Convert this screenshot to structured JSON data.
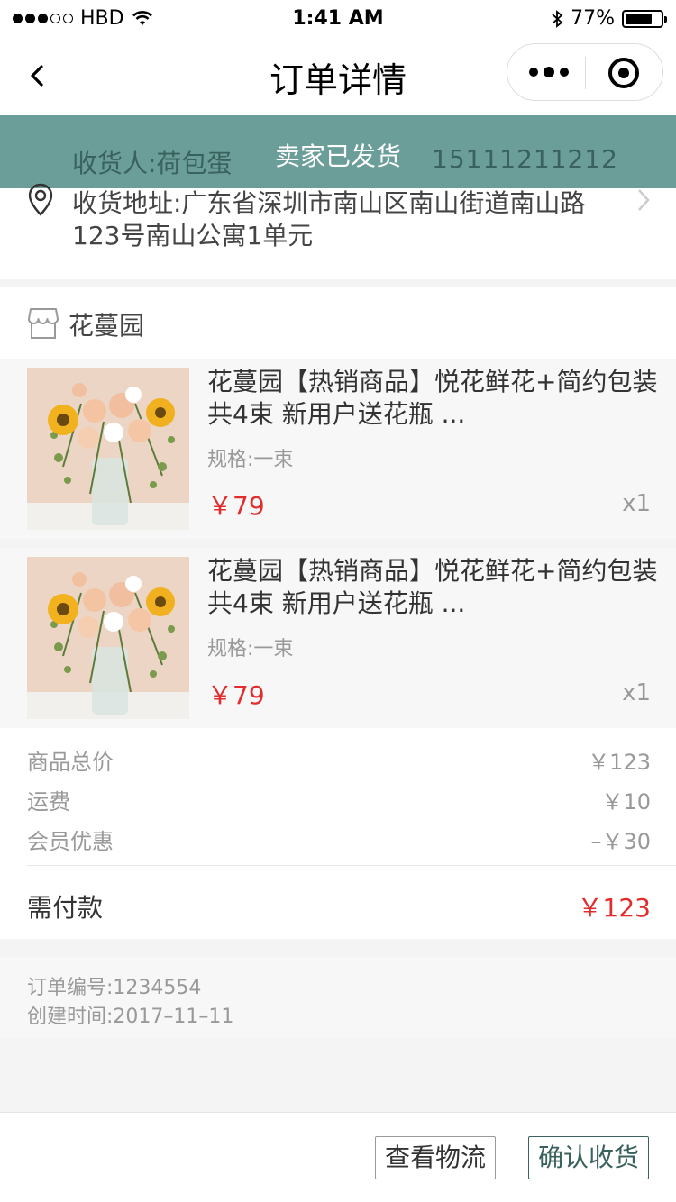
{
  "status_bar": {
    "carrier": "HBD",
    "time": "1:41 AM",
    "battery": "77%",
    "battery_level": 0.77
  },
  "nav": {
    "title": "订单详情"
  },
  "address": {
    "receiver": "收货人:荷包蛋",
    "phone": "15111211212",
    "order_status": "卖家已发货",
    "address_text": "收货地址:广东省深圳市南山区南山街道南山路123号南山公寓1单元"
  },
  "shop": {
    "name": "花蔓园"
  },
  "items": [
    {
      "title": "花蔓园【热销商品】悦花鲜花+简约包装共4束 新用户送花瓶 ...",
      "spec": "规格:一束",
      "price": "￥79",
      "qty": "x1"
    },
    {
      "title": "花蔓园【热销商品】悦花鲜花+简约包装共4束 新用户送花瓶 ...",
      "spec": "规格:一束",
      "price": "￥79",
      "qty": "x1"
    }
  ],
  "totals": {
    "goods_label": "商品总价",
    "goods_value": "￥123",
    "shipping_label": "运费",
    "shipping_value": "￥10",
    "discount_label": "会员优惠",
    "discount_value": "–￥30",
    "pay_label": "需付款",
    "pay_value": "￥123"
  },
  "order_info": {
    "number": "订单编号:1234554",
    "created": "创建时间:2017–11–11"
  },
  "footer": {
    "logistics_label": "查看物流",
    "confirm_label": "确认收货"
  },
  "colors": {
    "accent": "#6b9e99",
    "accent_dark": "#39615d",
    "price": "#e32c2c"
  }
}
